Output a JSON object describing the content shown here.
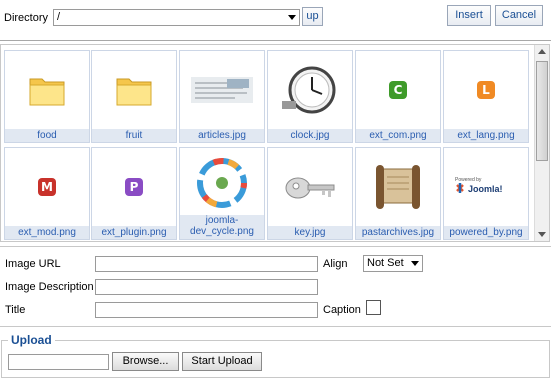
{
  "toolbar": {
    "directory_label": "Directory",
    "directory_value": "/",
    "up_label": "up",
    "insert_label": "Insert",
    "cancel_label": "Cancel"
  },
  "files": [
    {
      "name": "food",
      "kind": "folder"
    },
    {
      "name": "fruit",
      "kind": "folder"
    },
    {
      "name": "articles.jpg",
      "kind": "image-articles"
    },
    {
      "name": "clock.jpg",
      "kind": "image-clock"
    },
    {
      "name": "ext_com.png",
      "kind": "badge",
      "letter": "C",
      "color": "#3f9b2a"
    },
    {
      "name": "ext_lang.png",
      "kind": "badge",
      "letter": "L",
      "color": "#f08a24"
    },
    {
      "name": "ext_mod.png",
      "kind": "badge",
      "letter": "M",
      "color": "#c8322b"
    },
    {
      "name": "ext_plugin.png",
      "kind": "badge",
      "letter": "P",
      "color": "#8a4cc4"
    },
    {
      "name": "joomla-dev_cycle.png",
      "kind": "image-cycle"
    },
    {
      "name": "key.jpg",
      "kind": "image-key"
    },
    {
      "name": "pastarchives.jpg",
      "kind": "image-scroll"
    },
    {
      "name": "powered_by.png",
      "kind": "image-powered"
    }
  ],
  "form": {
    "image_url_label": "Image URL",
    "image_url_value": "",
    "align_label": "Align",
    "align_value": "Not Set",
    "image_description_label": "Image Description",
    "image_description_value": "",
    "title_label": "Title",
    "title_value": "",
    "caption_label": "Caption"
  },
  "upload": {
    "legend": "Upload",
    "browse_label": "Browse...",
    "start_upload_label": "Start Upload"
  },
  "colors": {
    "link_blue": "#2a5db0",
    "caption_bg": "#e1e8f2",
    "upload_legend": "#1a4f94"
  }
}
